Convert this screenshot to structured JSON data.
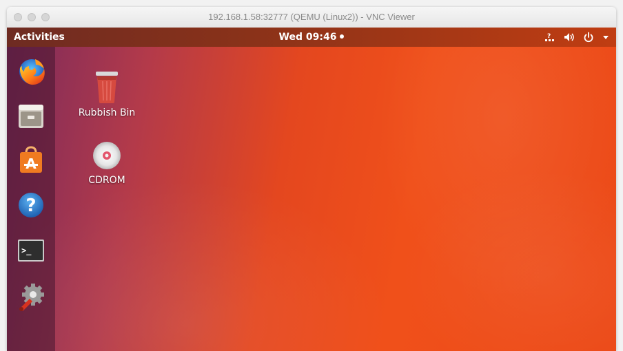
{
  "vnc_window": {
    "title": "192.168.1.58:32777 (QEMU (Linux2)) - VNC Viewer"
  },
  "top_bar": {
    "activities_label": "Activities",
    "clock": "Wed 09:46",
    "tray_icons": [
      "network-icon",
      "volume-icon",
      "power-icon",
      "chevron-down-icon"
    ]
  },
  "dock": {
    "items": [
      {
        "name": "Firefox Web Browser",
        "icon": "firefox-icon"
      },
      {
        "name": "Files",
        "icon": "files-icon"
      },
      {
        "name": "Ubuntu Software",
        "icon": "software-icon"
      },
      {
        "name": "Help",
        "icon": "help-icon"
      },
      {
        "name": "Terminal",
        "icon": "terminal-icon"
      },
      {
        "name": "System Settings",
        "icon": "settings-icon"
      }
    ]
  },
  "desktop_icons": [
    {
      "label": "Rubbish Bin",
      "icon": "trash-icon"
    },
    {
      "label": "CDROM",
      "icon": "cdrom-icon"
    }
  ],
  "colors": {
    "topbar": "#8a3219",
    "wallpaper_orange": "#f0501a",
    "wallpaper_purple": "#7a2a5c",
    "dock": "#46162f"
  }
}
